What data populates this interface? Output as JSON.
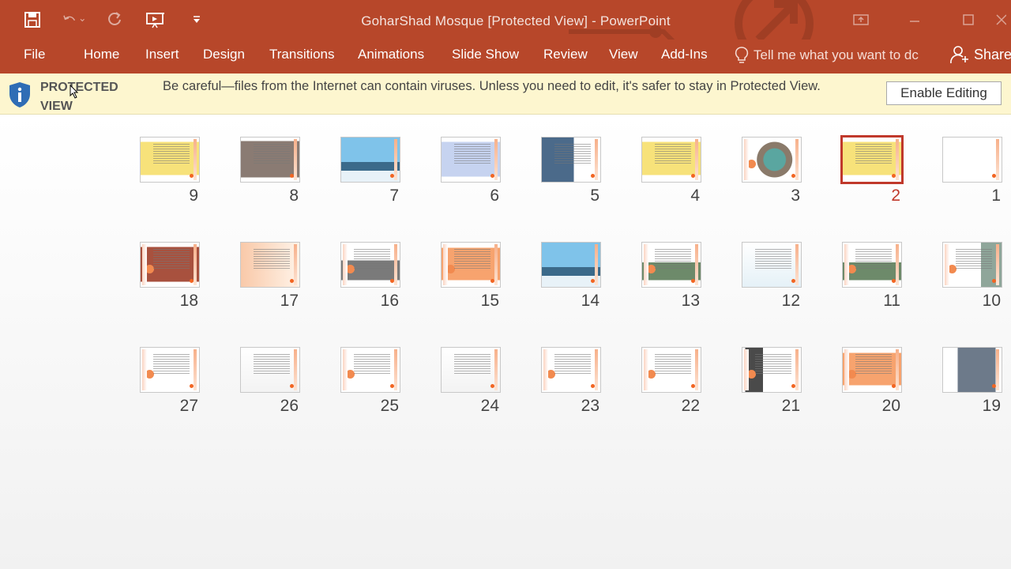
{
  "app": {
    "title": "GoharShad Mosque [Protected View] - PowerPoint",
    "brand_color": "#b7472a"
  },
  "ribbon": {
    "tabs": [
      "File",
      "Home",
      "Insert",
      "Design",
      "Transitions",
      "Animations",
      "Slide Show",
      "Review",
      "View",
      "Add-Ins"
    ],
    "tell_me": "Tell me what you want to dc",
    "share": "Share"
  },
  "protected_view": {
    "title": "PROTECTED VIEW",
    "message": "Be careful—files from the Internet can contain viruses. Unless you need to edit, it's safer to stay in Protected View.",
    "enable_button": "Enable Editing"
  },
  "slides": [
    {
      "number": "1",
      "selected": false,
      "style": "blank"
    },
    {
      "number": "2",
      "selected": true,
      "style": "yellow-text"
    },
    {
      "number": "3",
      "selected": false,
      "style": "photo-teal"
    },
    {
      "number": "4",
      "selected": false,
      "style": "yellow-text"
    },
    {
      "number": "5",
      "selected": false,
      "style": "photo-dome"
    },
    {
      "number": "6",
      "selected": false,
      "style": "blue-text"
    },
    {
      "number": "7",
      "selected": false,
      "style": "photo-sky"
    },
    {
      "number": "8",
      "selected": false,
      "style": "brown-text"
    },
    {
      "number": "9",
      "selected": false,
      "style": "yellow-text"
    },
    {
      "number": "10",
      "selected": false,
      "style": "text-photo"
    },
    {
      "number": "11",
      "selected": false,
      "style": "photo-text"
    },
    {
      "number": "12",
      "selected": false,
      "style": "blue-lines"
    },
    {
      "number": "13",
      "selected": false,
      "style": "photo-text"
    },
    {
      "number": "14",
      "selected": false,
      "style": "photo-sky"
    },
    {
      "number": "15",
      "selected": false,
      "style": "orange-text"
    },
    {
      "number": "16",
      "selected": false,
      "style": "text-photo-gray"
    },
    {
      "number": "17",
      "selected": false,
      "style": "orange-fade"
    },
    {
      "number": "18",
      "selected": false,
      "style": "photo-red"
    },
    {
      "number": "19",
      "selected": false,
      "style": "photo-arch"
    },
    {
      "number": "20",
      "selected": false,
      "style": "orange-text"
    },
    {
      "number": "21",
      "selected": false,
      "style": "photo-text-dark"
    },
    {
      "number": "22",
      "selected": false,
      "style": "text"
    },
    {
      "number": "23",
      "selected": false,
      "style": "text"
    },
    {
      "number": "24",
      "selected": false,
      "style": "text-light"
    },
    {
      "number": "25",
      "selected": false,
      "style": "text"
    },
    {
      "number": "26",
      "selected": false,
      "style": "text-light"
    },
    {
      "number": "27",
      "selected": false,
      "style": "text"
    }
  ]
}
